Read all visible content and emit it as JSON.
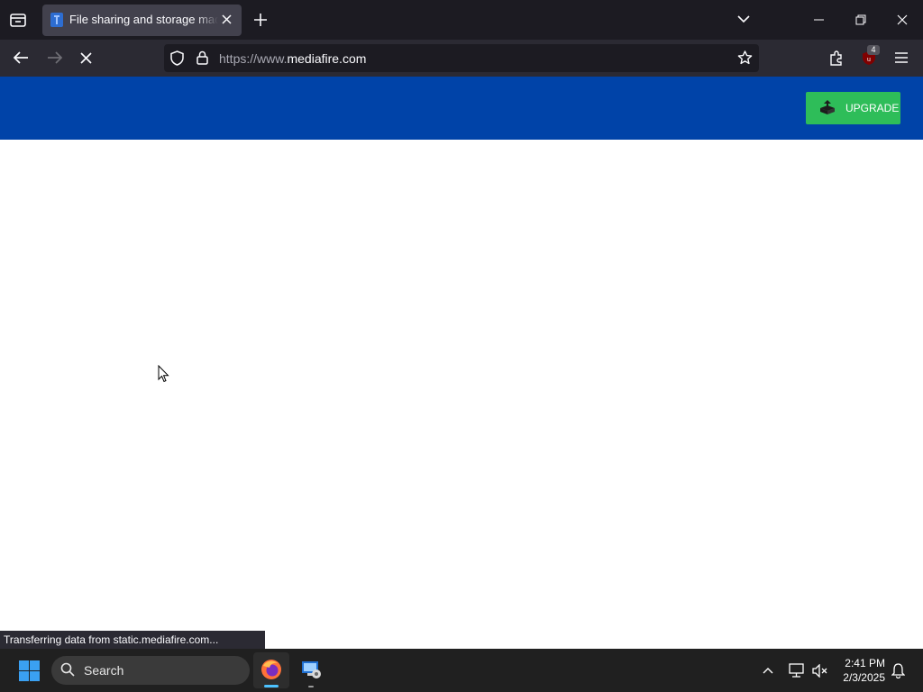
{
  "browser": {
    "tab": {
      "title": "File sharing and storage made simple"
    },
    "url": {
      "prefix": "https://www.",
      "domain": "mediafire.com"
    },
    "extension_badge": "4"
  },
  "page": {
    "upgrade_label": "UPGRADE"
  },
  "status_bar": {
    "text": "Transferring data from static.mediafire.com..."
  },
  "taskbar": {
    "search_label": "Search",
    "time": "2:41 PM",
    "date": "2/3/2025"
  },
  "colors": {
    "header_blue": "#0043a8",
    "upgrade_green": "#2ebd59",
    "browser_dark": "#1c1b22"
  }
}
